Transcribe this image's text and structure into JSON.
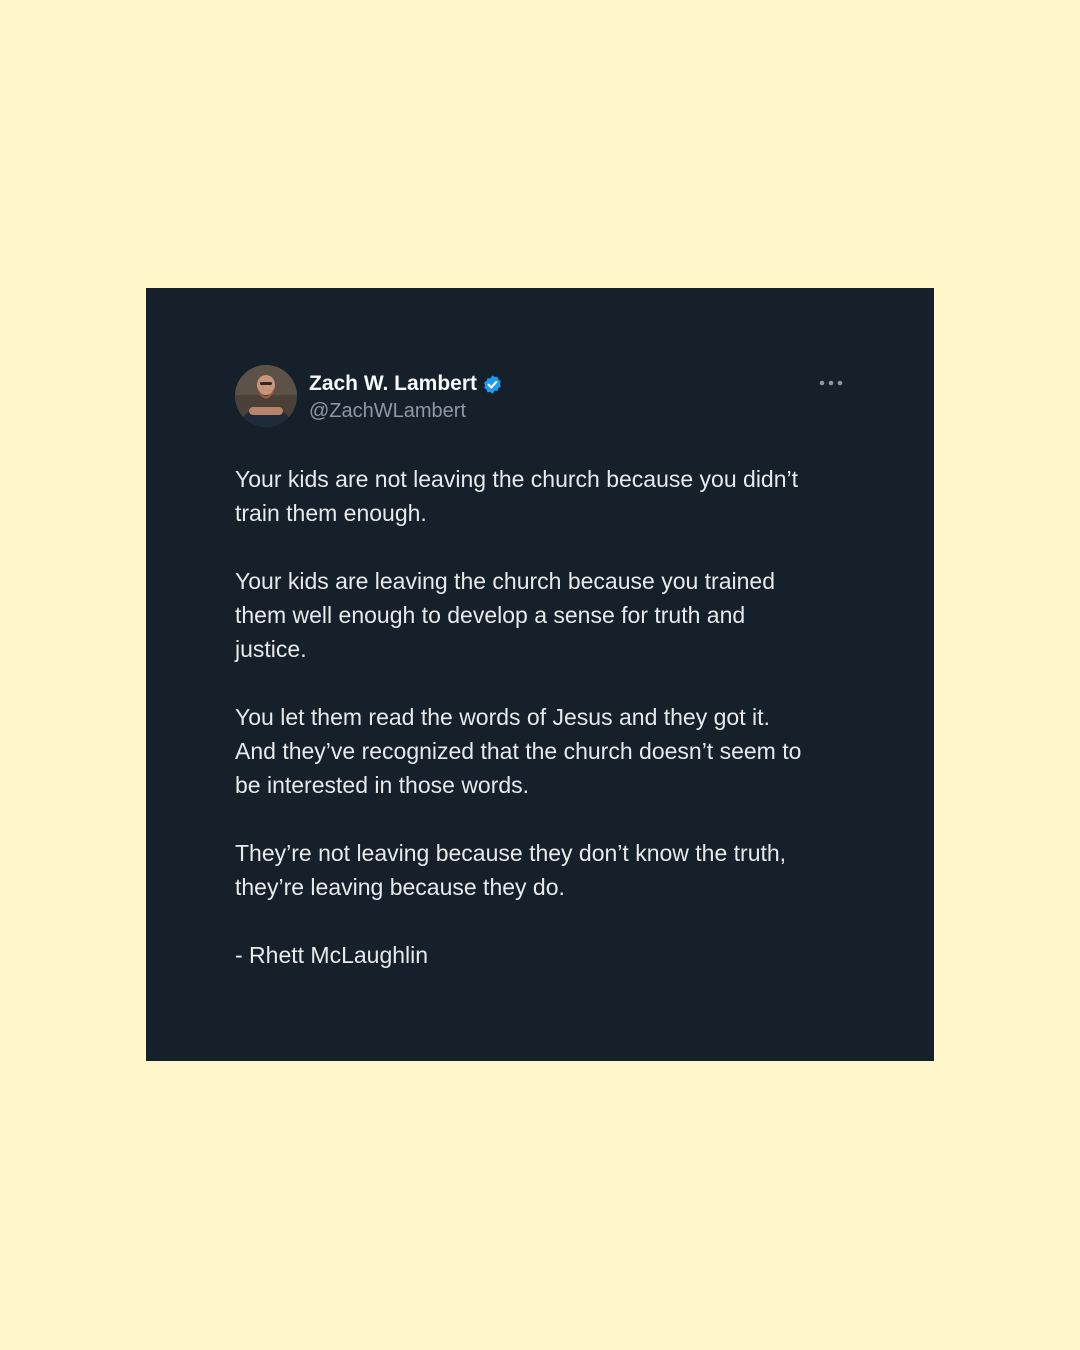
{
  "page": {
    "background_color": "#FFF6CA",
    "card_color": "#15202B"
  },
  "tweet": {
    "author": {
      "display_name": "Zach W. Lambert",
      "handle": "@ZachWLambert",
      "verified": true,
      "verified_icon": "verified-badge-icon",
      "verified_color": "#1D9BF0"
    },
    "more_icon": "more-options-icon",
    "paragraphs": [
      "Your kids are not leaving the church because you didn’t\ntrain them enough.",
      "Your kids are leaving the church because you trained\nthem well enough to develop a sense for truth and\njustice.",
      "You let them read the words of Jesus and they got it.\nAnd they’ve recognized that the church doesn’t seem to\nbe interested in those words.",
      "They’re not leaving because they don’t know the truth,\nthey’re leaving because they do.",
      "- Rhett McLaughlin"
    ]
  }
}
